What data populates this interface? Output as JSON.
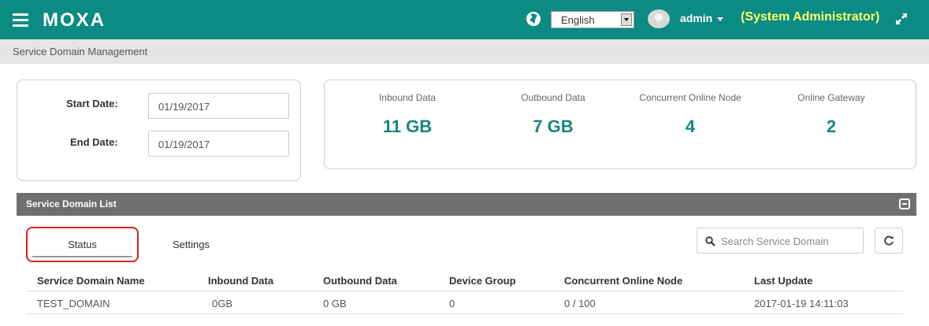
{
  "header": {
    "logo": "MOXA",
    "language": "English",
    "username": "admin",
    "role": "(System Administrator)",
    "bg_color": "#0b8b84",
    "role_color": "#ffff66"
  },
  "breadcrumb": "Service Domain Management",
  "date_filter": {
    "start_label": "Start Date:",
    "start_value": "01/19/2017",
    "end_label": "End Date:",
    "end_value": "01/19/2017"
  },
  "stats": [
    {
      "label": "Inbound Data",
      "value": "11 GB"
    },
    {
      "label": "Outbound Data",
      "value": "7 GB"
    },
    {
      "label": "Concurrent Online Node",
      "value": "4"
    },
    {
      "label": "Online Gateway",
      "value": "2"
    }
  ],
  "panel": {
    "title": "Service Domain List",
    "tabs": [
      "Status",
      "Settings"
    ],
    "search_placeholder": "Search Service Domain"
  },
  "table": {
    "columns": [
      "Service Domain Name",
      "Inbound Data",
      "Outbound Data",
      "Device Group",
      "Concurrent Online Node",
      "Last Update"
    ],
    "rows": [
      [
        "TEST_DOMAIN",
        "0GB",
        "0 GB",
        "0",
        "0 / 100",
        "2017-01-19 14:11:03"
      ]
    ]
  }
}
